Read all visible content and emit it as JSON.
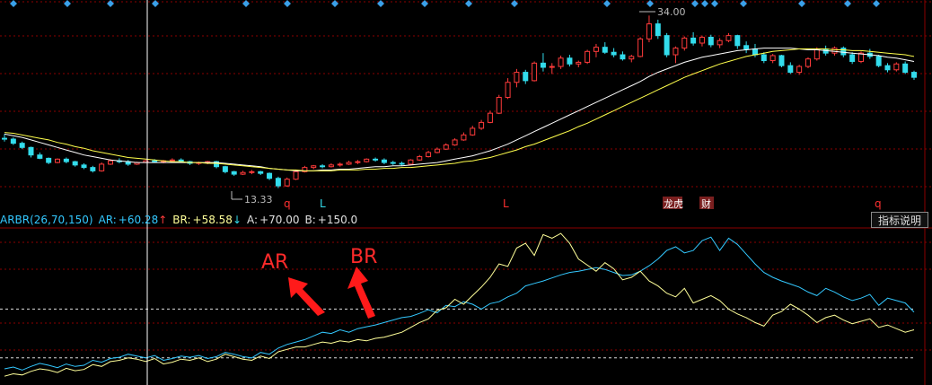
{
  "indicator": {
    "name": "ARBR(26,70,150)",
    "ar_label": "AR:",
    "ar_value": "+60.28",
    "ar_arrow": "↑",
    "br_label": "BR:",
    "br_value": "+58.58",
    "br_arrow": "↓",
    "a_label": "A:",
    "a_value": "+70.00",
    "b_label": "B:",
    "b_value": "+150.0"
  },
  "button": {
    "label": "指标说明"
  },
  "annotations": {
    "ar_text": "AR",
    "br_text": "BR"
  },
  "markers": {
    "q1": "q",
    "l1": "L",
    "l2": "L",
    "q2": "q",
    "tag_longhu": "龙虎",
    "tag_cai": "财"
  },
  "colors": {
    "up": "#ff3b3b",
    "down": "#33dcec",
    "ma1": "#ffffff",
    "ma2": "#ffff4c",
    "ar": "#33c8ff",
    "br": "#ffff99",
    "grid": "#8b0000",
    "accent": "#ff2020"
  },
  "chart_data": [
    {
      "type": "candlestick",
      "labels": {
        "low": "13.33",
        "high": "34.00"
      },
      "low_price": 13.33,
      "high_price": 34.0,
      "ylim": [
        12,
        35
      ],
      "ohlc": [
        [
          19.3,
          19.8,
          18.9,
          19.2
        ],
        [
          19.2,
          19.4,
          18.5,
          18.7
        ],
        [
          18.7,
          18.9,
          18.0,
          18.2
        ],
        [
          18.2,
          18.3,
          17.0,
          17.3
        ],
        [
          17.3,
          17.6,
          16.8,
          16.9
        ],
        [
          16.9,
          17.0,
          16.2,
          16.4
        ],
        [
          16.4,
          16.9,
          16.3,
          16.8
        ],
        [
          16.8,
          17.0,
          16.3,
          16.5
        ],
        [
          16.5,
          16.6,
          15.9,
          16.1
        ],
        [
          16.1,
          16.3,
          15.6,
          15.8
        ],
        [
          15.8,
          16.0,
          15.2,
          15.4
        ],
        [
          15.4,
          16.4,
          15.3,
          16.2
        ],
        [
          16.2,
          16.8,
          16.1,
          16.6
        ],
        [
          16.6,
          16.9,
          16.3,
          16.5
        ],
        [
          16.5,
          16.7,
          16.0,
          16.2
        ],
        [
          16.2,
          16.5,
          16.1,
          16.4
        ],
        [
          16.4,
          16.7,
          16.3,
          16.6
        ],
        [
          16.6,
          16.8,
          16.4,
          16.5
        ],
        [
          16.5,
          16.7,
          16.3,
          16.6
        ],
        [
          16.6,
          16.9,
          16.5,
          16.7
        ],
        [
          16.7,
          16.9,
          16.4,
          16.5
        ],
        [
          16.5,
          16.6,
          16.1,
          16.3
        ],
        [
          16.3,
          16.5,
          16.1,
          16.4
        ],
        [
          16.4,
          16.6,
          16.2,
          16.5
        ],
        [
          16.5,
          16.6,
          15.7,
          15.9
        ],
        [
          15.9,
          16.0,
          15.1,
          15.3
        ],
        [
          15.3,
          15.4,
          14.8,
          15.0
        ],
        [
          15.0,
          15.4,
          14.9,
          15.2
        ],
        [
          15.2,
          15.5,
          15.0,
          15.3
        ],
        [
          15.3,
          15.4,
          14.9,
          15.1
        ],
        [
          15.1,
          15.2,
          14.3,
          14.5
        ],
        [
          14.5,
          14.7,
          13.33,
          13.6
        ],
        [
          13.6,
          14.6,
          13.5,
          14.4
        ],
        [
          14.4,
          15.5,
          14.3,
          15.3
        ],
        [
          15.3,
          16.0,
          15.2,
          15.8
        ],
        [
          15.8,
          16.1,
          15.6,
          16.0
        ],
        [
          16.0,
          16.2,
          15.7,
          15.9
        ],
        [
          15.9,
          16.3,
          15.8,
          16.1
        ],
        [
          16.1,
          16.4,
          15.9,
          16.2
        ],
        [
          16.2,
          16.6,
          16.1,
          16.4
        ],
        [
          16.4,
          16.7,
          16.2,
          16.5
        ],
        [
          16.5,
          16.9,
          16.4,
          16.8
        ],
        [
          16.8,
          17.0,
          16.5,
          16.7
        ],
        [
          16.7,
          16.9,
          16.2,
          16.4
        ],
        [
          16.4,
          16.6,
          16.1,
          16.3
        ],
        [
          16.3,
          16.5,
          16.0,
          16.2
        ],
        [
          16.2,
          16.8,
          16.1,
          16.7
        ],
        [
          16.7,
          17.3,
          16.6,
          17.1
        ],
        [
          17.1,
          17.8,
          17.0,
          17.6
        ],
        [
          17.6,
          18.2,
          17.5,
          18.0
        ],
        [
          18.0,
          18.7,
          17.9,
          18.5
        ],
        [
          18.5,
          19.3,
          18.4,
          19.1
        ],
        [
          19.1,
          20.0,
          19.0,
          19.7
        ],
        [
          19.7,
          20.8,
          19.6,
          20.5
        ],
        [
          20.5,
          21.5,
          20.3,
          21.2
        ],
        [
          21.2,
          22.6,
          21.1,
          22.3
        ],
        [
          22.3,
          24.5,
          22.2,
          24.2
        ],
        [
          24.2,
          26.5,
          24.0,
          26.0
        ],
        [
          26.0,
          27.6,
          25.4,
          27.2
        ],
        [
          27.2,
          27.5,
          25.8,
          26.2
        ],
        [
          26.2,
          28.5,
          26.1,
          28.3
        ],
        [
          28.3,
          29.5,
          27.3,
          27.8
        ],
        [
          27.8,
          28.3,
          27.0,
          27.9
        ],
        [
          27.9,
          29.2,
          27.6,
          28.9
        ],
        [
          28.9,
          29.3,
          27.9,
          28.2
        ],
        [
          28.2,
          28.6,
          27.8,
          28.4
        ],
        [
          28.4,
          29.9,
          28.2,
          29.7
        ],
        [
          29.7,
          30.6,
          29.0,
          30.2
        ],
        [
          30.2,
          30.8,
          29.4,
          29.6
        ],
        [
          29.6,
          30.1,
          29.0,
          29.3
        ],
        [
          29.3,
          29.7,
          28.6,
          28.8
        ],
        [
          28.8,
          29.3,
          28.4,
          29.1
        ],
        [
          29.1,
          31.4,
          29.0,
          31.2
        ],
        [
          31.2,
          34.0,
          30.8,
          33.0
        ],
        [
          33.0,
          33.5,
          31.2,
          31.6
        ],
        [
          31.6,
          31.9,
          29.0,
          29.3
        ],
        [
          29.3,
          30.3,
          28.3,
          30.1
        ],
        [
          30.1,
          31.5,
          29.8,
          31.3
        ],
        [
          31.3,
          32.0,
          30.4,
          30.7
        ],
        [
          30.7,
          31.6,
          30.3,
          31.4
        ],
        [
          31.4,
          31.7,
          30.2,
          30.5
        ],
        [
          30.5,
          31.3,
          30.1,
          31.0
        ],
        [
          31.0,
          31.9,
          30.8,
          31.6
        ],
        [
          31.6,
          31.7,
          30.0,
          30.4
        ],
        [
          30.4,
          30.9,
          29.5,
          30.0
        ],
        [
          30.0,
          30.6,
          29.0,
          29.3
        ],
        [
          29.3,
          29.6,
          28.3,
          28.6
        ],
        [
          28.6,
          29.4,
          28.3,
          29.2
        ],
        [
          29.2,
          29.3,
          27.8,
          28.0
        ],
        [
          28.0,
          28.4,
          27.0,
          27.2
        ],
        [
          27.2,
          28.1,
          26.9,
          27.9
        ],
        [
          27.9,
          29.0,
          27.7,
          28.8
        ],
        [
          28.8,
          30.2,
          28.6,
          30.0
        ],
        [
          30.0,
          30.4,
          29.2,
          29.5
        ],
        [
          29.5,
          30.3,
          29.2,
          30.1
        ],
        [
          30.1,
          30.3,
          29.0,
          29.3
        ],
        [
          29.3,
          29.6,
          28.2,
          28.5
        ],
        [
          28.5,
          29.7,
          28.3,
          29.5
        ],
        [
          29.5,
          30.0,
          28.8,
          29.1
        ],
        [
          29.1,
          29.3,
          27.8,
          28.0
        ],
        [
          28.0,
          28.3,
          27.2,
          27.5
        ],
        [
          27.5,
          28.4,
          27.3,
          28.2
        ],
        [
          28.2,
          28.5,
          27.0,
          27.2
        ],
        [
          27.2,
          27.4,
          26.3,
          26.6
        ]
      ],
      "ma_fast": [
        19.8,
        19.6,
        19.4,
        19.1,
        18.8,
        18.5,
        18.2,
        17.9,
        17.6,
        17.3,
        17.1,
        16.9,
        16.7,
        16.6,
        16.5,
        16.4,
        16.4,
        16.4,
        16.4,
        16.4,
        16.4,
        16.4,
        16.4,
        16.4,
        16.4,
        16.3,
        16.2,
        16.1,
        16.0,
        15.9,
        15.7,
        15.6,
        15.5,
        15.4,
        15.4,
        15.4,
        15.5,
        15.5,
        15.6,
        15.6,
        15.7,
        15.8,
        15.9,
        15.9,
        16.0,
        16.0,
        16.1,
        16.2,
        16.3,
        16.4,
        16.6,
        16.8,
        17.0,
        17.2,
        17.5,
        17.8,
        18.2,
        18.6,
        19.1,
        19.6,
        20.1,
        20.6,
        21.1,
        21.6,
        22.1,
        22.6,
        23.1,
        23.6,
        24.1,
        24.6,
        25.1,
        25.6,
        26.1,
        26.7,
        27.2,
        27.6,
        28.0,
        28.4,
        28.7,
        29.0,
        29.2,
        29.4,
        29.6,
        29.8,
        29.9,
        30.0,
        30.1,
        30.1,
        30.1,
        30.1,
        30.0,
        29.9,
        29.9,
        29.8,
        29.7,
        29.6,
        29.5,
        29.4,
        29.3,
        29.2,
        29.0,
        28.9,
        28.7,
        28.5
      ],
      "ma_slow": [
        20.0,
        19.9,
        19.7,
        19.5,
        19.3,
        19.1,
        18.8,
        18.6,
        18.3,
        18.1,
        17.8,
        17.6,
        17.4,
        17.2,
        17.0,
        16.9,
        16.8,
        16.7,
        16.6,
        16.5,
        16.5,
        16.4,
        16.4,
        16.3,
        16.3,
        16.2,
        16.1,
        16.0,
        15.9,
        15.8,
        15.7,
        15.6,
        15.5,
        15.5,
        15.4,
        15.4,
        15.4,
        15.4,
        15.5,
        15.5,
        15.5,
        15.6,
        15.6,
        15.7,
        15.7,
        15.8,
        15.8,
        15.9,
        16.0,
        16.1,
        16.2,
        16.3,
        16.5,
        16.6,
        16.8,
        17.0,
        17.3,
        17.6,
        17.9,
        18.3,
        18.6,
        19.0,
        19.4,
        19.8,
        20.2,
        20.7,
        21.1,
        21.6,
        22.1,
        22.6,
        23.1,
        23.6,
        24.1,
        24.6,
        25.1,
        25.6,
        26.1,
        26.6,
        27.0,
        27.4,
        27.8,
        28.2,
        28.5,
        28.8,
        29.1,
        29.3,
        29.5,
        29.7,
        29.8,
        29.9,
        30.0,
        30.0,
        30.0,
        30.0,
        29.9,
        29.9,
        29.8,
        29.8,
        29.7,
        29.6,
        29.5,
        29.4,
        29.3,
        29.1
      ]
    },
    {
      "type": "line",
      "title": "ARBR(26,70,150)",
      "ylim": [
        30,
        280
      ],
      "reference_lines": [
        {
          "name": "A",
          "value": 70
        },
        {
          "name": "B",
          "value": 150
        }
      ],
      "series": [
        {
          "name": "AR",
          "values": [
            52,
            55,
            50,
            56,
            61,
            58,
            54,
            60,
            56,
            58,
            66,
            63,
            69,
            71,
            76,
            73,
            70,
            74,
            66,
            69,
            73,
            71,
            74,
            69,
            72,
            79,
            76,
            72,
            70,
            79,
            76,
            86,
            92,
            96,
            100,
            106,
            112,
            110,
            116,
            112,
            118,
            121,
            124,
            128,
            132,
            136,
            138,
            143,
            149,
            144,
            156,
            154,
            162,
            158,
            150,
            159,
            162,
            170,
            176,
            188,
            192,
            196,
            201,
            206,
            210,
            212,
            215,
            218,
            215,
            210,
            205,
            206,
            212,
            221,
            232,
            246,
            252,
            242,
            246,
            262,
            268,
            246,
            266,
            256,
            240,
            224,
            210,
            202,
            196,
            191,
            186,
            178,
            172,
            184,
            178,
            170,
            164,
            168,
            174,
            156,
            168,
            164,
            160,
            145
          ]
        },
        {
          "name": "BR",
          "values": [
            40,
            44,
            42,
            48,
            52,
            50,
            46,
            53,
            49,
            51,
            59,
            56,
            64,
            66,
            70,
            68,
            64,
            69,
            60,
            63,
            68,
            66,
            70,
            64,
            68,
            76,
            72,
            68,
            66,
            73,
            69,
            80,
            84,
            88,
            88,
            92,
            96,
            94,
            98,
            96,
            100,
            98,
            102,
            104,
            108,
            112,
            120,
            128,
            134,
            148,
            152,
            166,
            158,
            172,
            186,
            202,
            224,
            220,
            250,
            258,
            238,
            272,
            266,
            274,
            258,
            232,
            222,
            212,
            226,
            216,
            198,
            202,
            212,
            196,
            188,
            176,
            170,
            184,
            160,
            166,
            172,
            164,
            150,
            142,
            136,
            128,
            122,
            140,
            146,
            158,
            150,
            140,
            128,
            136,
            140,
            132,
            126,
            130,
            134,
            120,
            124,
            118,
            112,
            116
          ]
        }
      ]
    }
  ]
}
